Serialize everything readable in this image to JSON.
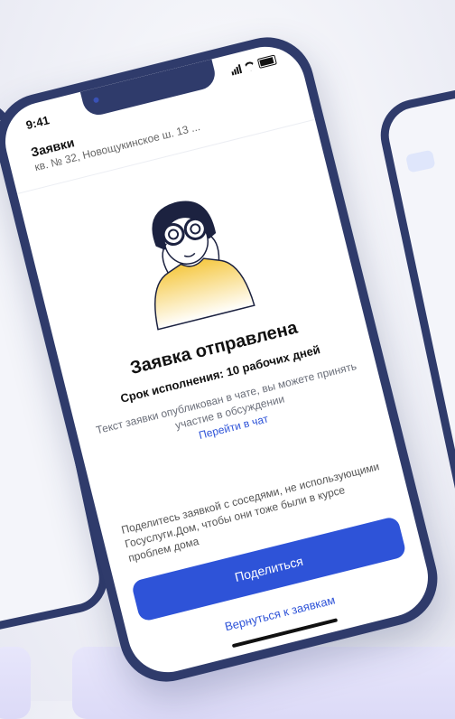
{
  "status_bar": {
    "time": "9:41"
  },
  "header": {
    "title": "Заявки",
    "subtitle": "кв. № 32, Новощукинское ш. 13 ..."
  },
  "result": {
    "title": "Заявка отправлена",
    "deadline": "Срок исполнения: 10 рабочих дней",
    "description": "Текст заявки опубликован в чате, вы можете принять участие в обсуждении",
    "chat_link": "Перейти в чат"
  },
  "share": {
    "text": "Поделитесь заявкой с соседями, не использующими Госуслуги.Дом, чтобы они тоже были в курсе проблем дома",
    "button_label": "Поделиться"
  },
  "back_link": "Вернуться к заявкам",
  "colors": {
    "accent": "#2e53d8",
    "frame": "#2f3b6b",
    "illustration_gradient": "#f5c842"
  }
}
